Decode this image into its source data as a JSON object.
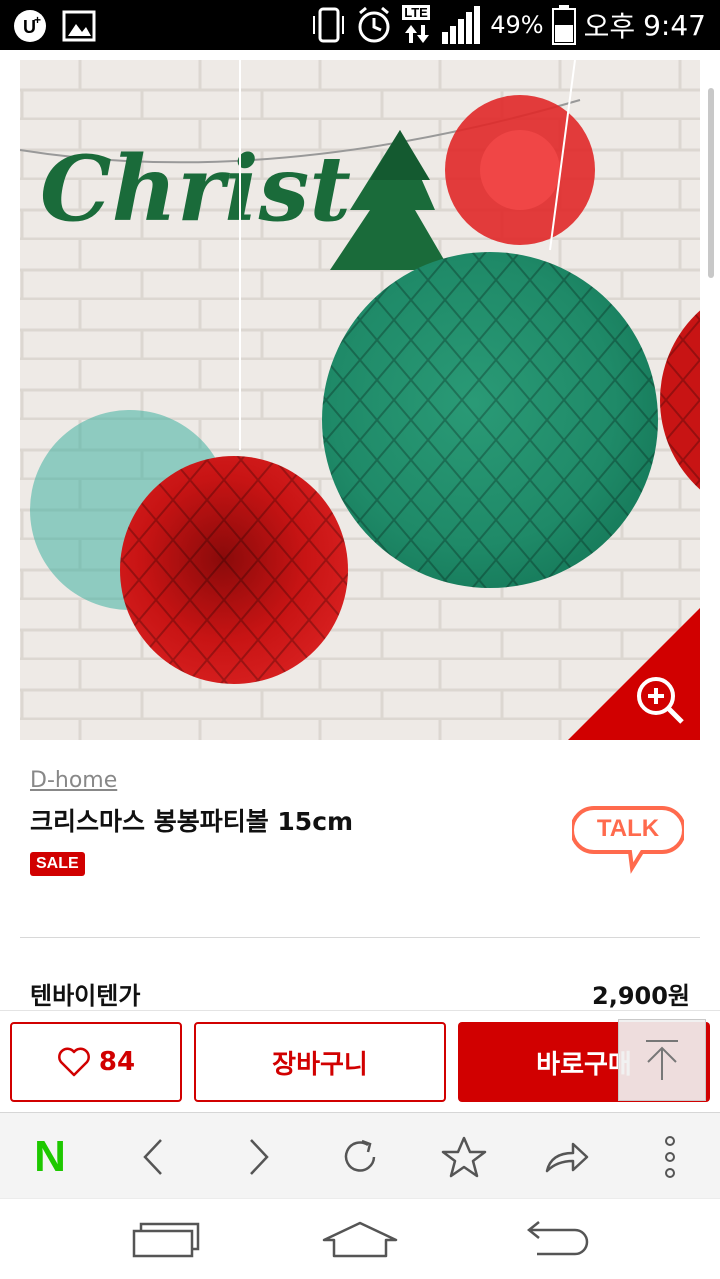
{
  "status_bar": {
    "battery_percent": "49%",
    "network_label": "LTE",
    "ampm": "오후",
    "time": "9:47",
    "icons": [
      "uplus-icon",
      "gallery-icon",
      "vibrate-icon",
      "alarm-icon",
      "lte-icon",
      "signal-icon",
      "battery-icon"
    ]
  },
  "product": {
    "image_words": "Christ",
    "brand": "D-home",
    "name": "크리스마스 봉봉파티볼 15cm",
    "badge": "SALE",
    "talk_label": "TALK",
    "price_label": "텐바이텐가",
    "price_value": "2,900원"
  },
  "actions": {
    "like_count": "84",
    "cart_label": "장바구니",
    "buy_label": "바로구매"
  },
  "browser_toolbar": {
    "home_label": "N",
    "icons": [
      "naver-home",
      "back-icon",
      "forward-icon",
      "refresh-icon",
      "bookmark-star-icon",
      "share-icon",
      "more-icon"
    ]
  },
  "nav_bar": {
    "icons": [
      "recent-apps-icon",
      "home-icon",
      "back-icon"
    ]
  },
  "colors": {
    "accent": "#d10000",
    "naver_green": "#1ec800",
    "talk_orange": "#ff6a4d"
  }
}
